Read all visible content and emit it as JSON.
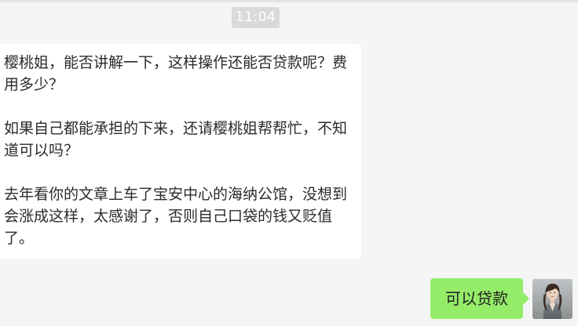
{
  "conversation": {
    "timestamp": "11:04",
    "incoming_message": {
      "paragraph_1": "樱桃姐，能否讲解一下，这样操作还能否贷款呢？费用多少？",
      "paragraph_2": "如果自己都能承担的下来，还请樱桃姐帮帮忙，不知道可以吗？",
      "paragraph_3": "去年看你的文章上车了宝安中心的海纳公馆，没想到会涨成这样，太感谢了，否则自己口袋的钱又贬值了。"
    },
    "outgoing_message": {
      "text": "可以贷款"
    }
  },
  "colors": {
    "background": "#f5f5f5",
    "incoming_bubble": "#ffffff",
    "outgoing_bubble": "#95ec69",
    "timestamp_badge": "#dadada"
  },
  "icons": {
    "avatar": "user-avatar-photo"
  }
}
